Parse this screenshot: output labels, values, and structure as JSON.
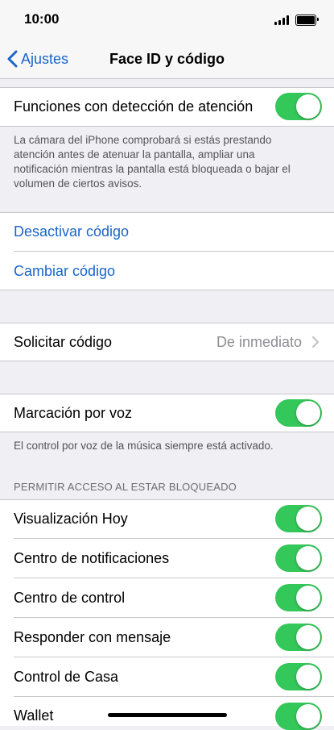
{
  "status": {
    "time": "10:00"
  },
  "nav": {
    "back_label": "Ajustes",
    "title": "Face ID y código"
  },
  "attention": {
    "label": "Funciones con detección de atención",
    "enabled": true,
    "footer": "La cámara del iPhone comprobará si estás prestando atención antes de atenuar la pantalla, ampliar una notificación mientras la pantalla está bloqueada o bajar el volumen de ciertos avisos."
  },
  "passcode": {
    "disable_label": "Desactivar código",
    "change_label": "Cambiar código"
  },
  "require": {
    "label": "Solicitar código",
    "value": "De inmediato"
  },
  "voice_dial": {
    "label": "Marcación por voz",
    "enabled": true,
    "footer": "El control por voz de la música siempre está activado."
  },
  "locked_access": {
    "header": "PERMITIR ACCESO AL ESTAR BLOQUEADO",
    "items": [
      {
        "label": "Visualización Hoy",
        "enabled": true
      },
      {
        "label": "Centro de notificaciones",
        "enabled": true
      },
      {
        "label": "Centro de control",
        "enabled": true
      },
      {
        "label": "Responder con mensaje",
        "enabled": true
      },
      {
        "label": "Control de Casa",
        "enabled": true
      },
      {
        "label": "Wallet",
        "enabled": true
      }
    ]
  },
  "colors": {
    "accent": "#1b64c8",
    "toggle_on": "#34c759",
    "background": "#efeff4"
  }
}
